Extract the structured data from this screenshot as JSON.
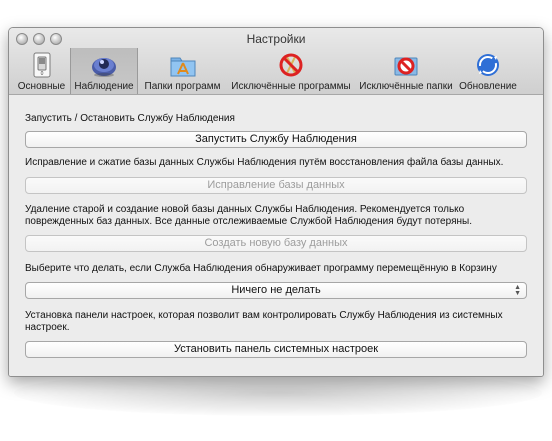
{
  "window": {
    "title": "Настройки"
  },
  "tabs": [
    {
      "label": "Основные",
      "icon": "switch-icon"
    },
    {
      "label": "Наблюдение",
      "icon": "eye-lens-icon"
    },
    {
      "label": "Папки программ",
      "icon": "applications-folder-icon"
    },
    {
      "label": "Исключённые программы",
      "icon": "prohibited-app-icon"
    },
    {
      "label": "Исключённые папки",
      "icon": "prohibited-folder-icon"
    },
    {
      "label": "Обновление",
      "icon": "update-globe-icon"
    }
  ],
  "selected_tab": "Наблюдение",
  "sections": {
    "start_stop": {
      "label": "Запустить / Остановить Службу Наблюдения",
      "button": "Запустить Службу Наблюдения"
    },
    "repair": {
      "label": "Исправление и сжатие базы данных Службы Наблюдения путём восстановления файла базы данных.",
      "button": "Исправление базы данных"
    },
    "recreate": {
      "label_line1": "Удаление старой и создание новой базы данных Службы Наблюдения. Рекомендуется только",
      "label_line2": "поврежденных баз данных. Все данные отслеживаемые Службой Наблюдения будут потеряны.",
      "button": "Создать новую базу данных"
    },
    "trash_action": {
      "label": "Выберите что делать, если Служба Наблюдения обнаруживает программу перемещённую в Корзину",
      "selected": "Ничего не делать"
    },
    "prefpane": {
      "label_line1": "Установка панели настроек, которая позволит вам контролировать Службу Наблюдения из системных",
      "label_line2": "настроек.",
      "button": "Установить панель системных настроек"
    }
  }
}
